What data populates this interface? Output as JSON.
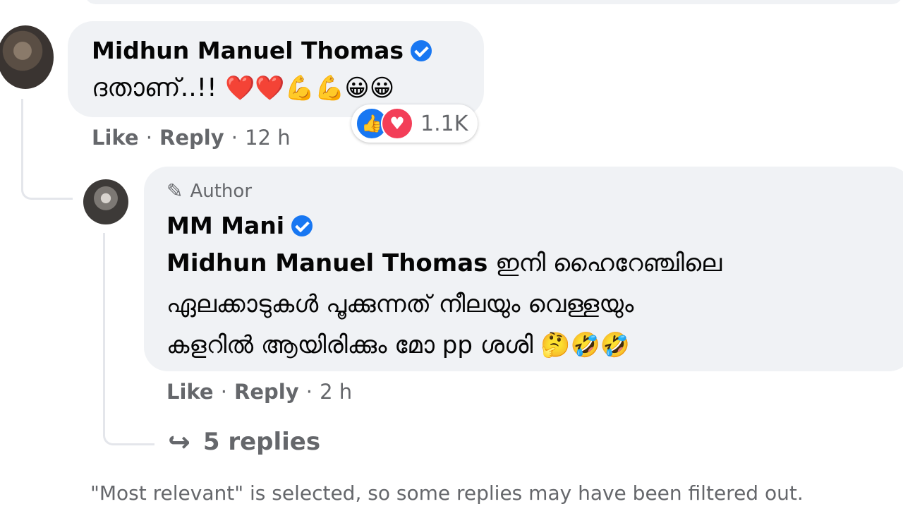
{
  "comment1": {
    "author": "Midhun Manuel Thomas",
    "text": "ദതാണ്..!!",
    "emojis": "❤️❤️💪💪😀😀",
    "actions": {
      "like": "Like",
      "reply": "Reply",
      "sep": "·",
      "time": "12 h"
    },
    "reactions": {
      "count": "1.1K",
      "icons": [
        "like-icon",
        "love-icon"
      ]
    }
  },
  "reply1": {
    "badge": "Author",
    "author": "MM Mani",
    "mention": "Midhun Manuel Thomas",
    "line1": " ഇനി ഹൈറേഞ്ചിലെ",
    "line2": "ഏലക്കാടുകൾ പൂക്കുന്നത് നീലയും വെള്ളയും",
    "line3": "കളറിൽ ആയിരിക്കും മോ pp ശശി",
    "emojis": "🤔🤣🤣",
    "actions": {
      "like": "Like",
      "reply": "Reply",
      "sep": "·",
      "time": "2 h"
    }
  },
  "replies_link": "5 replies",
  "filter_note": "\"Most relevant\" is selected, so some replies may have been filtered out.",
  "colors": {
    "bubble": "#f0f2f5",
    "verified": "#1877f2",
    "secondary_text": "#65676b",
    "love": "#f33e58"
  }
}
